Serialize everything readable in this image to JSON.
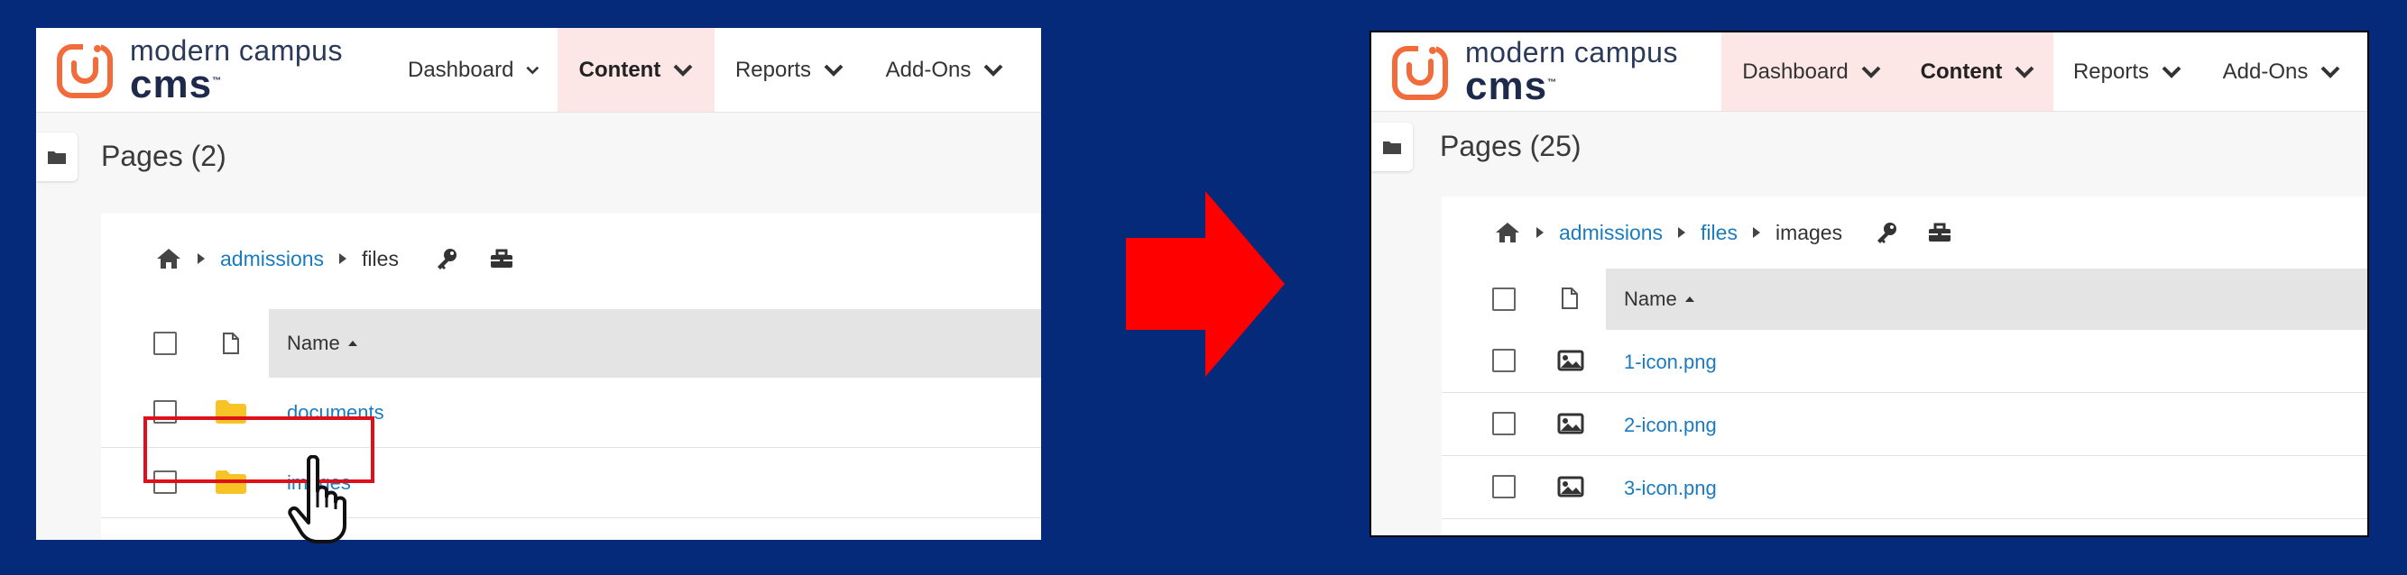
{
  "brand": {
    "line1": "modern campus",
    "line2": "cms",
    "tm": "™",
    "accent_color": "#f26b3a"
  },
  "nav": {
    "dashboard": "Dashboard",
    "content": "Content",
    "reports": "Reports",
    "addons": "Add-Ons"
  },
  "left": {
    "pages_title": "Pages (2)",
    "breadcrumb": {
      "link1": "admissions",
      "current": "files"
    },
    "table_header": "Name",
    "rows": [
      {
        "label": "documents",
        "icon": "folder-icon"
      },
      {
        "label": "images",
        "icon": "folder-icon"
      }
    ]
  },
  "right": {
    "pages_title": "Pages (25)",
    "breadcrumb": {
      "link1": "admissions",
      "link2": "files",
      "current": "images"
    },
    "table_header": "Name",
    "rows": [
      {
        "label": "1-icon.png",
        "icon": "image-icon"
      },
      {
        "label": "2-icon.png",
        "icon": "image-icon"
      },
      {
        "label": "3-icon.png",
        "icon": "image-icon"
      }
    ]
  },
  "colors": {
    "background": "#062a7a",
    "arrow": "#ff0000",
    "highlight": "#e0101a",
    "link": "#1a7bbf",
    "folder": "#f7c325",
    "active_nav": "#fde6e6"
  }
}
